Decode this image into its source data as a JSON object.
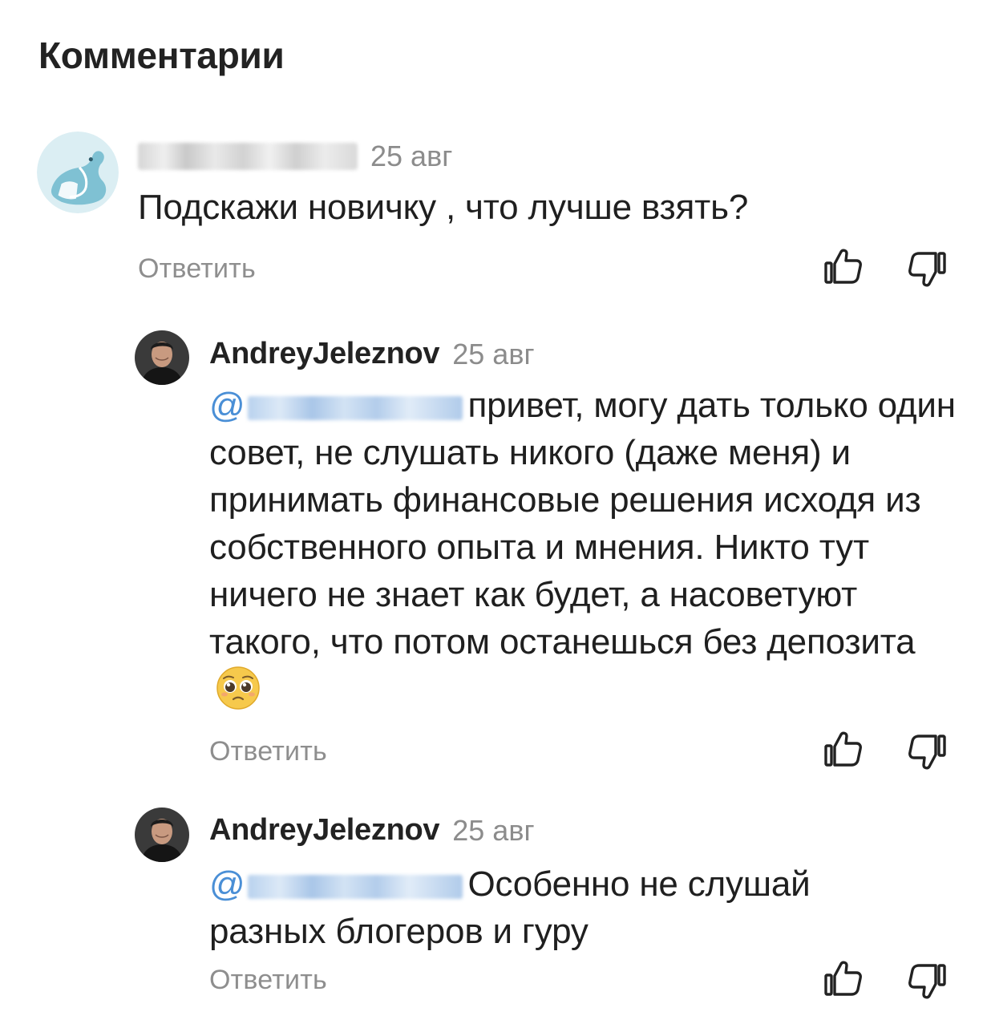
{
  "section_title": "Комментарии",
  "comments": [
    {
      "author": "",
      "date": "25 авг",
      "text": "Подскажи новичку , что лучше взять?",
      "reply_label": "Ответить",
      "avatar_icon": "otter-avatar-icon"
    },
    {
      "author": "AndreyJeleznov",
      "date": "25 авг",
      "mention_prefix": "@",
      "text": "привет, могу дать только один совет, не слушать никого (даже меня) и принимать финансовые решения исходя из собственного опыта и мнения. Никто тут ничего не знает как будет, а насоветуют такого, что потом останешься без депозита",
      "emoji_icon": "pleading-face-emoji",
      "reply_label": "Ответить",
      "avatar_icon": "user-photo-avatar"
    },
    {
      "author": "AndreyJeleznov",
      "date": "25 авг",
      "mention_prefix": "@",
      "text": "Особенно не слушай разных блогеров и гуру",
      "reply_label": "Ответить",
      "avatar_icon": "user-photo-avatar"
    }
  ],
  "icons": {
    "like": "thumbs-up-icon",
    "dislike": "thumbs-down-icon"
  },
  "colors": {
    "mention": "#4a8fd6",
    "muted": "#8e8e8e",
    "text": "#1f1f1f"
  }
}
